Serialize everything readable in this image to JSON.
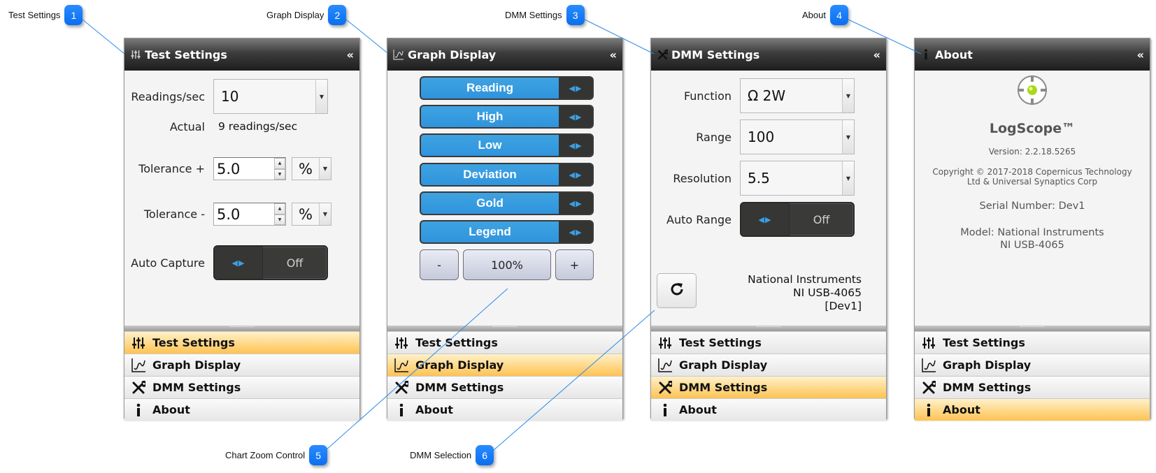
{
  "callouts": [
    {
      "num": "1",
      "label": "Test Settings"
    },
    {
      "num": "2",
      "label": "Graph Display"
    },
    {
      "num": "3",
      "label": "DMM Settings"
    },
    {
      "num": "4",
      "label": "About"
    },
    {
      "num": "5",
      "label": "Chart Zoom Control"
    },
    {
      "num": "6",
      "label": "DMM Selection"
    }
  ],
  "nav": {
    "items": [
      {
        "label": "Test Settings",
        "icon": "sliders-icon"
      },
      {
        "label": "Graph Display",
        "icon": "graph-icon"
      },
      {
        "label": "DMM Settings",
        "icon": "wrench-icon"
      },
      {
        "label": "About",
        "icon": "info-icon"
      }
    ]
  },
  "collapse_glyph": "«",
  "test_settings": {
    "title": "Test Settings",
    "readings_label": "Readings/sec",
    "readings_value": "10",
    "actual_label": "Actual",
    "actual_value": "9 readings/sec",
    "tol_plus_label": "Tolerance +",
    "tol_plus_value": "5.0",
    "tol_plus_unit": "%",
    "tol_minus_label": "Tolerance -",
    "tol_minus_value": "5.0",
    "tol_minus_unit": "%",
    "auto_capture_label": "Auto Capture",
    "auto_capture_value": "Off",
    "active_nav": "Test Settings"
  },
  "graph_display": {
    "title": "Graph Display",
    "series": [
      "Reading",
      "High",
      "Low",
      "Deviation",
      "Gold",
      "Legend"
    ],
    "zoom_out": "-",
    "zoom_level": "100%",
    "zoom_in": "+",
    "active_nav": "Graph Display"
  },
  "dmm_settings": {
    "title": "DMM Settings",
    "function_label": "Function",
    "function_value": "Ω 2W",
    "range_label": "Range",
    "range_value": "100",
    "resolution_label": "Resolution",
    "resolution_value": "5.5",
    "auto_range_label": "Auto Range",
    "auto_range_value": "Off",
    "device_line1": "National Instruments",
    "device_line2": "NI USB-4065",
    "device_line3": "[Dev1]",
    "active_nav": "DMM Settings"
  },
  "about": {
    "title": "About",
    "product": "LogScope™",
    "version": "Version: 2.2.18.5265",
    "copyright1": "Copyright © 2017-2018 Copernicus Technology",
    "copyright2": "Ltd & Universal Synaptics Corp",
    "serial": "Serial Number: Dev1",
    "model1": "Model: National Instruments",
    "model2": "NI USB-4065",
    "active_nav": "About"
  },
  "colors": {
    "accent_blue": "#2f94de",
    "active_nav": "#fdc353",
    "header_dark": "#1e1e1e",
    "callout_blue": "#0a6ef0"
  }
}
